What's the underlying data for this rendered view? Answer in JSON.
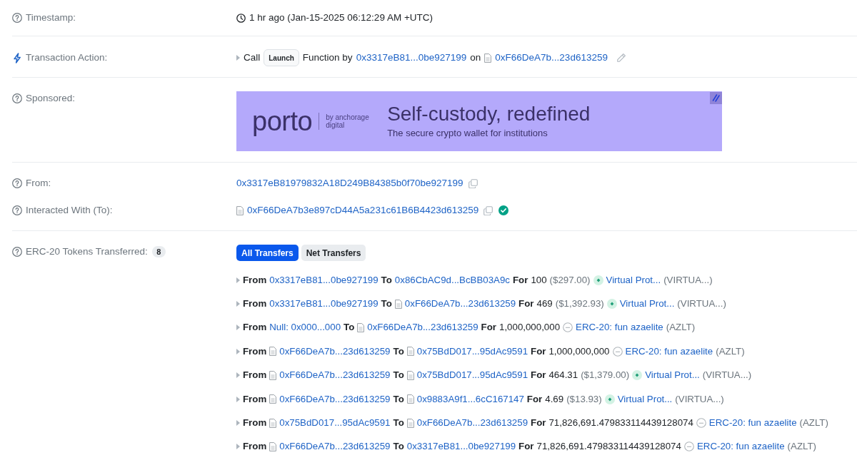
{
  "timestamp": {
    "label": "Timestamp:",
    "value": "1 hr ago (Jan-15-2025 06:12:29 AM +UTC)"
  },
  "transaction_action": {
    "label": "Transaction Action:",
    "call_text": "Call",
    "method": "Launch",
    "function_text": "Function by",
    "caller": {
      "text": "0x3317eB81...0be927199",
      "contract": false
    },
    "on_text": "on",
    "target": {
      "text": "0xF66DeA7b...23d613259",
      "contract": true
    }
  },
  "sponsored": {
    "label": "Sponsored:",
    "ad": {
      "brand": "porto",
      "byline": "by anchorage digital",
      "headline": "Self-custody, redefined",
      "tagline": "The secure crypto wallet for institutions"
    }
  },
  "from": {
    "label": "From:",
    "address": {
      "text": "0x3317eB81979832A18D249B84385b0f70be927199",
      "contract": false
    }
  },
  "interacted_with": {
    "label": "Interacted With (To):",
    "address": {
      "text": "0xF66DeA7b3e897cD44A5a231c61B6B4423d613259",
      "contract": true
    },
    "verified": true
  },
  "erc20_transfers": {
    "label": "ERC-20 Tokens Transferred:",
    "count": "8",
    "tabs": [
      {
        "label": "All Transfers",
        "selected": true
      },
      {
        "label": "Net Transfers",
        "selected": false
      }
    ],
    "rows": [
      {
        "from_text": "From",
        "from": {
          "text": "0x3317eB81...0be927199",
          "contract": false
        },
        "to_text": "To",
        "to": {
          "text": "0x86CbAC9d...BcBB03A9c",
          "contract": false
        },
        "for_text": "For",
        "amount": "100",
        "usd": "($297.00)",
        "token": {
          "kind": "logo",
          "name": "Virtual Prot...",
          "symbol": "(VIRTUA...)"
        }
      },
      {
        "from_text": "From",
        "from": {
          "text": "0x3317eB81...0be927199",
          "contract": false
        },
        "to_text": "To",
        "to": {
          "text": "0xF66DeA7b...23d613259",
          "contract": true
        },
        "for_text": "For",
        "amount": "469",
        "usd": "($1,392.93)",
        "token": {
          "kind": "logo",
          "name": "Virtual Prot...",
          "symbol": "(VIRTUA...)"
        }
      },
      {
        "from_text": "From",
        "from": {
          "text": "Null: 0x000...000",
          "contract": false
        },
        "to_text": "To",
        "to": {
          "text": "0xF66DeA7b...23d613259",
          "contract": true
        },
        "for_text": "For",
        "amount": "1,000,000,000",
        "token": {
          "kind": "default",
          "name": "ERC-20: fun azaelite",
          "symbol": "(AZLT)"
        }
      },
      {
        "from_text": "From",
        "from": {
          "text": "0xF66DeA7b...23d613259",
          "contract": true
        },
        "to_text": "To",
        "to": {
          "text": "0x75BdD017...95dAc9591",
          "contract": true
        },
        "for_text": "For",
        "amount": "1,000,000,000",
        "token": {
          "kind": "default",
          "name": "ERC-20: fun azaelite",
          "symbol": "(AZLT)"
        }
      },
      {
        "from_text": "From",
        "from": {
          "text": "0xF66DeA7b...23d613259",
          "contract": true
        },
        "to_text": "To",
        "to": {
          "text": "0x75BdD017...95dAc9591",
          "contract": true
        },
        "for_text": "For",
        "amount": "464.31",
        "usd": "($1,379.00)",
        "token": {
          "kind": "logo",
          "name": "Virtual Prot...",
          "symbol": "(VIRTUA...)"
        }
      },
      {
        "from_text": "From",
        "from": {
          "text": "0xF66DeA7b...23d613259",
          "contract": true
        },
        "to_text": "To",
        "to": {
          "text": "0x9883A9f1...6cC167147",
          "contract": true
        },
        "for_text": "For",
        "amount": "4.69",
        "usd": "($13.93)",
        "token": {
          "kind": "logo",
          "name": "Virtual Prot...",
          "symbol": "(VIRTUA...)"
        }
      },
      {
        "from_text": "From",
        "from": {
          "text": "0x75BdD017...95dAc9591",
          "contract": true
        },
        "to_text": "To",
        "to": {
          "text": "0xF66DeA7b...23d613259",
          "contract": true
        },
        "for_text": "For",
        "amount": "71,826,691.479833114439128074",
        "token": {
          "kind": "default",
          "name": "ERC-20: fun azaelite",
          "symbol": "(AZLT)"
        }
      },
      {
        "from_text": "From",
        "from": {
          "text": "0xF66DeA7b...23d613259",
          "contract": true
        },
        "to_text": "To",
        "to": {
          "text": "0x3317eB81...0be927199",
          "contract": false
        },
        "for_text": "For",
        "amount": "71,826,691.479833114439128074",
        "token": {
          "kind": "default",
          "name": "ERC-20: fun azaelite",
          "symbol": "(AZLT)"
        }
      }
    ]
  }
}
